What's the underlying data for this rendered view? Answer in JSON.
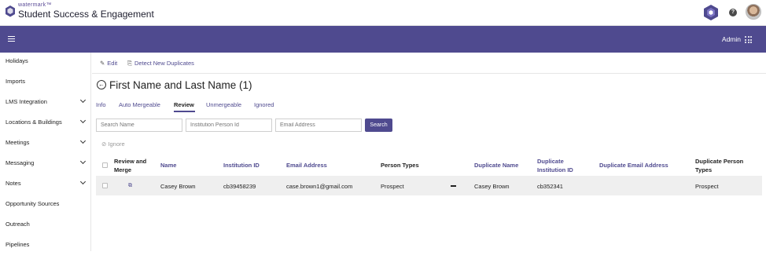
{
  "header": {
    "brand_small": "watermark™",
    "brand_title": "Student Success & Engagement"
  },
  "navbar": {
    "admin_label": "Admin"
  },
  "sidebar": {
    "items": [
      {
        "label": "Holidays",
        "has_chevron": false
      },
      {
        "label": "Imports",
        "has_chevron": false
      },
      {
        "label": "LMS Integration",
        "has_chevron": true
      },
      {
        "label": "Locations & Buildings",
        "has_chevron": true
      },
      {
        "label": "Meetings",
        "has_chevron": true
      },
      {
        "label": "Messaging",
        "has_chevron": true
      },
      {
        "label": "Notes",
        "has_chevron": true
      },
      {
        "label": "Opportunity Sources",
        "has_chevron": false
      },
      {
        "label": "Outreach",
        "has_chevron": false
      },
      {
        "label": "Pipelines",
        "has_chevron": false
      }
    ]
  },
  "toolbar": {
    "edit_label": "Edit",
    "detect_label": "Detect New Duplicates"
  },
  "page": {
    "title": "First Name and Last Name (1)"
  },
  "tabs": [
    {
      "label": "Info",
      "active": false
    },
    {
      "label": "Auto Mergeable",
      "active": false
    },
    {
      "label": "Review",
      "active": true
    },
    {
      "label": "Unmergeable",
      "active": false
    },
    {
      "label": "Ignored",
      "active": false
    }
  ],
  "search": {
    "name_placeholder": "Search Name",
    "id_placeholder": "Institution Person Id",
    "email_placeholder": "Email Address",
    "button_label": "Search"
  },
  "ignore_label": "Ignore",
  "table": {
    "headers": {
      "review_merge": "Review and Merge",
      "name": "Name",
      "institution_id": "Institution ID",
      "email": "Email Address",
      "person_types": "Person Types",
      "dup_name": "Duplicate Name",
      "dup_institution_id": "Duplicate Institution ID",
      "dup_email": "Duplicate Email Address",
      "dup_person_types": "Duplicate Person Types"
    },
    "rows": [
      {
        "name": "Casey Brown",
        "institution_id": "cb39458239",
        "email": "case.brown1@gmail.com",
        "person_types": "Prospect",
        "dup_name": "Casey Brown",
        "dup_institution_id": "cb352341",
        "dup_email": "",
        "dup_person_types": "Prospect"
      }
    ]
  },
  "colors": {
    "primary": "#4f4a8f",
    "row_bg": "#efefef"
  }
}
